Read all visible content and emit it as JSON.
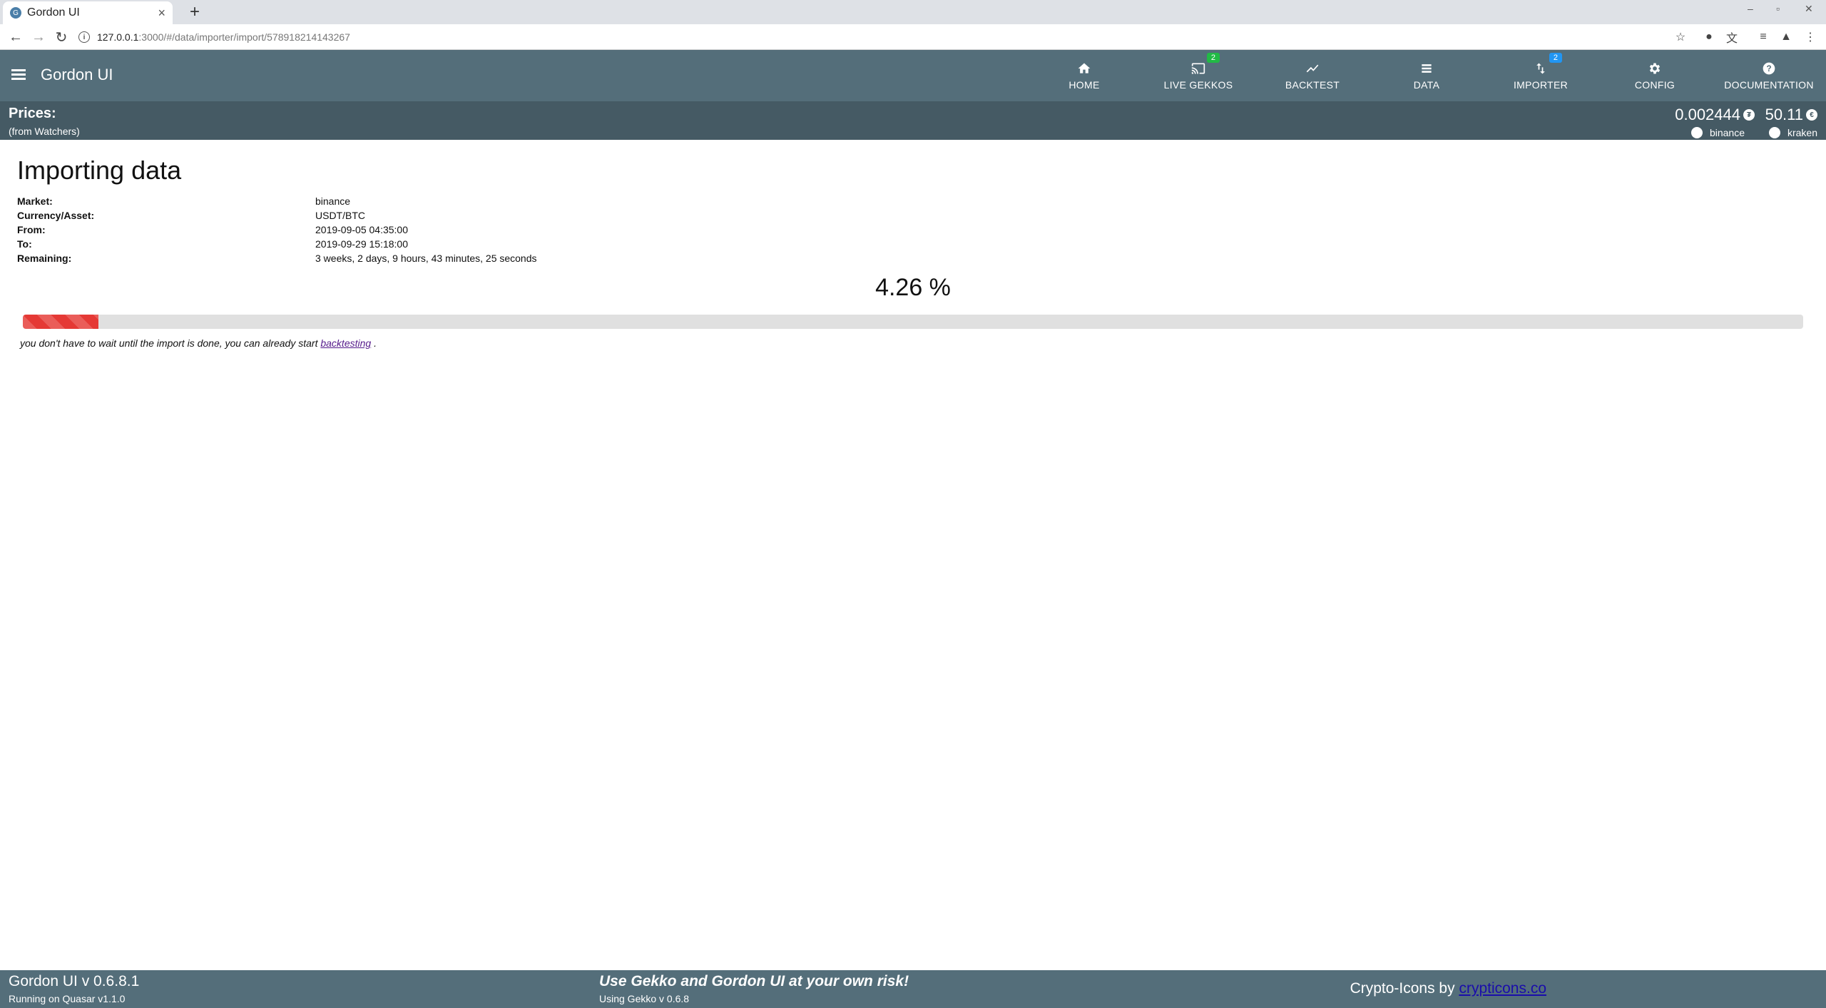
{
  "browser": {
    "tab_title": "Gordon UI",
    "url_host": "127.0.0.1",
    "url_path": ":3000/#/data/importer/import/578918214143267"
  },
  "header": {
    "title": "Gordon UI",
    "nav": [
      {
        "label": "HOME",
        "icon": "home-icon"
      },
      {
        "label": "LIVE GEKKOS",
        "icon": "cast-icon",
        "badge": "2",
        "badge_color": "#21ba45"
      },
      {
        "label": "BACKTEST",
        "icon": "trending-up-icon"
      },
      {
        "label": "DATA",
        "icon": "list-icon"
      },
      {
        "label": "IMPORTER",
        "icon": "import-export-icon",
        "badge": "2",
        "badge_color": "#2196f3"
      },
      {
        "label": "CONFIG",
        "icon": "gear-icon"
      },
      {
        "label": "DOCUMENTATION",
        "icon": "help-icon"
      }
    ]
  },
  "prices": {
    "title": "Prices:",
    "subtitle": "(from Watchers)",
    "tickers": [
      {
        "value": "0.002444",
        "exchange": "binance"
      },
      {
        "value": "50.11",
        "exchange": "kraken"
      }
    ]
  },
  "import": {
    "title": "Importing data",
    "fields": [
      {
        "key": "Market:",
        "value": "binance"
      },
      {
        "key": "Currency/Asset:",
        "value": "USDT/BTC"
      },
      {
        "key": "From:",
        "value": "2019-09-05 04:35:00"
      },
      {
        "key": "To:",
        "value": "2019-09-29 15:18:00"
      },
      {
        "key": "Remaining:",
        "value": "3 weeks, 2 days, 9 hours, 43 minutes, 25 seconds"
      }
    ],
    "percent_label": "4.26 %",
    "progress": 0.0426,
    "hint_before": "you don't have to wait until the import is done, you can already start ",
    "hint_link": "backtesting",
    "hint_after": " ."
  },
  "footer": {
    "version": "Gordon UI v 0.6.8.1",
    "quasar": "Running on Quasar v1.1.0",
    "warning": "Use Gekko and Gordon UI at your own risk!",
    "gekko": "Using Gekko v 0.6.8",
    "credits_prefix": "Crypto-Icons by ",
    "credits_link": "crypticons.co"
  },
  "colors": {
    "header": "#546e7a",
    "prices_bar": "#455a64",
    "progress": "#e53935"
  }
}
